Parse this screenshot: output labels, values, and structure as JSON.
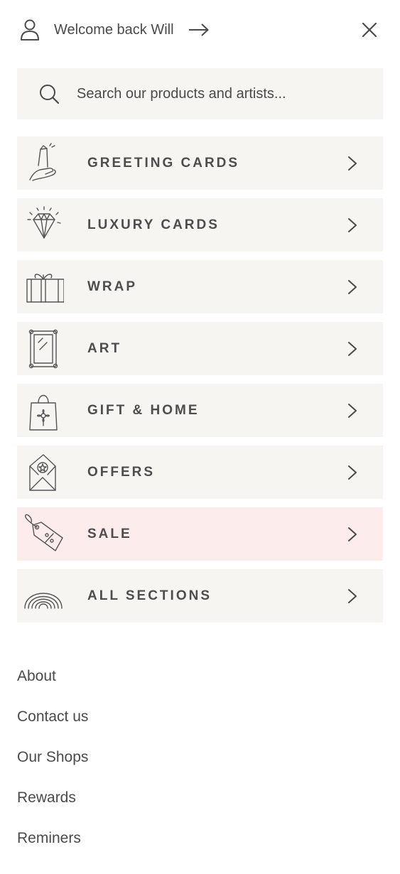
{
  "header": {
    "welcome_text": "Welcome back Will",
    "user_icon": "user-icon",
    "arrow_icon": "arrow-right-icon",
    "close_icon": "close-icon"
  },
  "search": {
    "placeholder": "Search our products and artists...",
    "value": "",
    "icon": "search-icon"
  },
  "menu": {
    "items": [
      {
        "label": "GREETING CARDS",
        "icon": "greeting-card-hand-icon"
      },
      {
        "label": "LUXURY CARDS",
        "icon": "diamond-icon"
      },
      {
        "label": "WRAP",
        "icon": "gift-box-icon"
      },
      {
        "label": "ART",
        "icon": "picture-frame-icon"
      },
      {
        "label": "GIFT & HOME",
        "icon": "tote-bag-icon"
      },
      {
        "label": "OFFERS",
        "icon": "envelope-icon"
      },
      {
        "label": "SALE",
        "icon": "price-tag-icon"
      },
      {
        "label": "ALL SECTIONS",
        "icon": "rainbow-icon"
      }
    ],
    "chevron_icon": "chevron-right-icon"
  },
  "footer": {
    "links": [
      "About",
      "Contact us",
      "Our Shops",
      "Rewards",
      "Reminers"
    ]
  },
  "colors": {
    "item_background": "#f6f5f2",
    "sale_background": "#fdecec",
    "text": "#4a4a4a"
  }
}
